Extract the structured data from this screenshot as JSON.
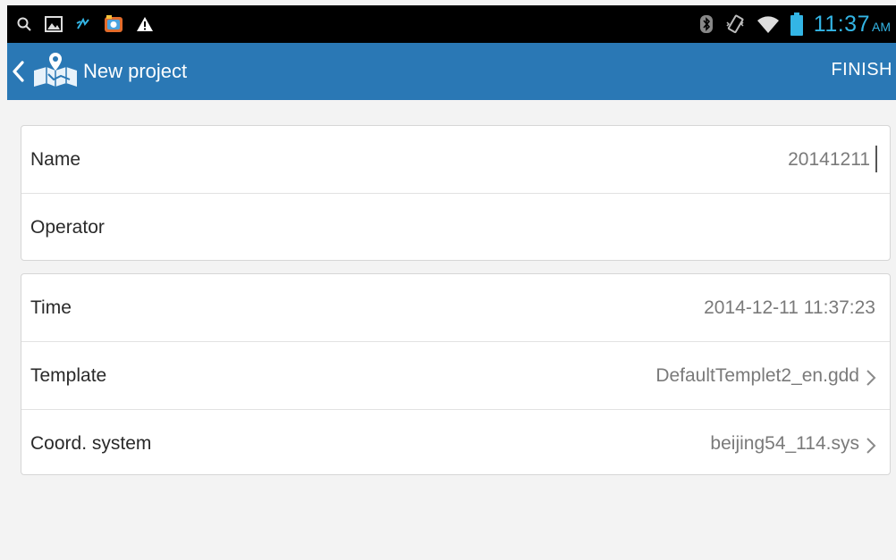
{
  "status_bar": {
    "left_icons": [
      "search-icon",
      "image-icon",
      "sync-icon",
      "photo-app-icon",
      "warning-icon"
    ],
    "right_icons": [
      "bluetooth-icon",
      "vibrate-icon",
      "wifi-icon",
      "battery-icon"
    ],
    "time": "11:37",
    "ampm": "AM",
    "accent_color": "#33b5e5"
  },
  "action_bar": {
    "title": "New project",
    "finish_label": "FINISH",
    "background": "#2a78b5"
  },
  "project_info": [
    {
      "label": "Name",
      "value": "20141211"
    },
    {
      "label": "Operator",
      "value": ""
    }
  ],
  "project_settings": [
    {
      "label": "Time",
      "value": "2014-12-11 11:37:23"
    },
    {
      "label": "Template",
      "value": "DefaultTemplet2_en.gdd"
    },
    {
      "label": "Coord. system",
      "value": "beijing54_114.sys"
    }
  ]
}
